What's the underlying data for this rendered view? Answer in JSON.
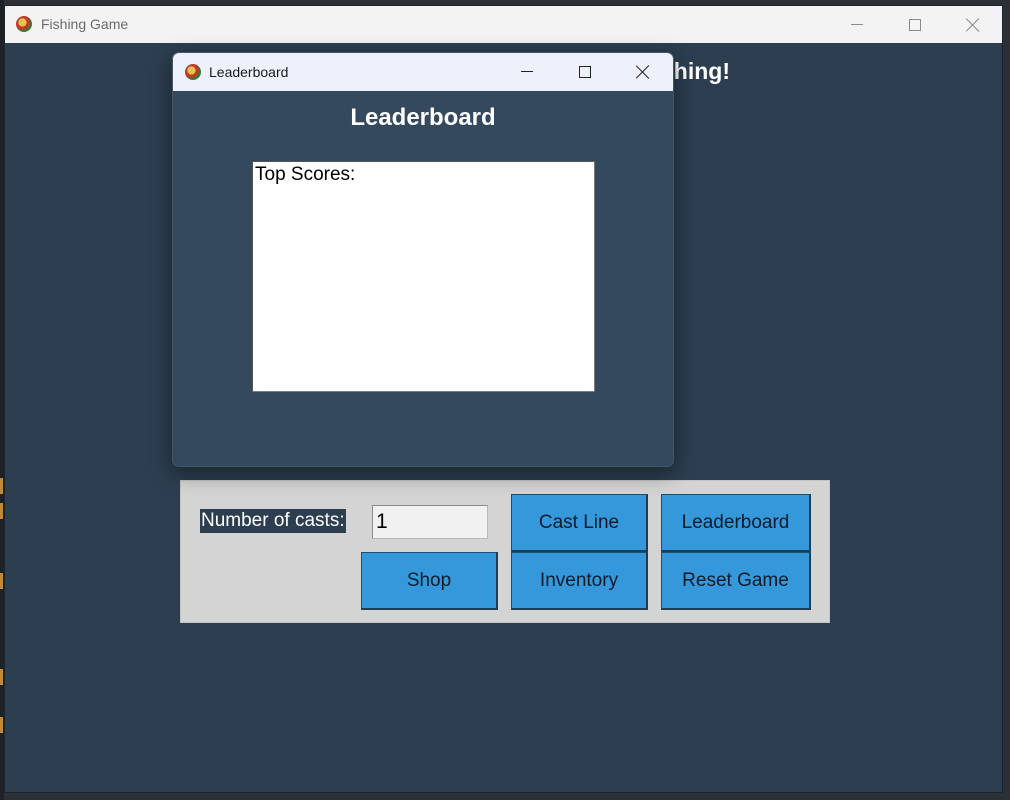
{
  "main_window": {
    "title": "Fishing Game",
    "heading_visible_fragment": "hing!"
  },
  "controls": {
    "casts_label": "Number of casts:",
    "casts_value": "1",
    "cast_line_label": "Cast Line",
    "leaderboard_label": "Leaderboard",
    "shop_label": "Shop",
    "inventory_label": "Inventory",
    "reset_label": "Reset Game"
  },
  "leaderboard_dialog": {
    "title": "Leaderboard",
    "heading": "Leaderboard",
    "scores_text": "Top Scores:"
  },
  "colors": {
    "window_bg": "#2c3e50",
    "dialog_bg": "#34495e",
    "button_bg": "#3498db",
    "panel_bg": "#d4d4d4"
  },
  "icons": {
    "app": "fishing-game-app-icon",
    "minimize": "minimize-icon",
    "maximize": "maximize-icon",
    "close": "close-icon"
  }
}
